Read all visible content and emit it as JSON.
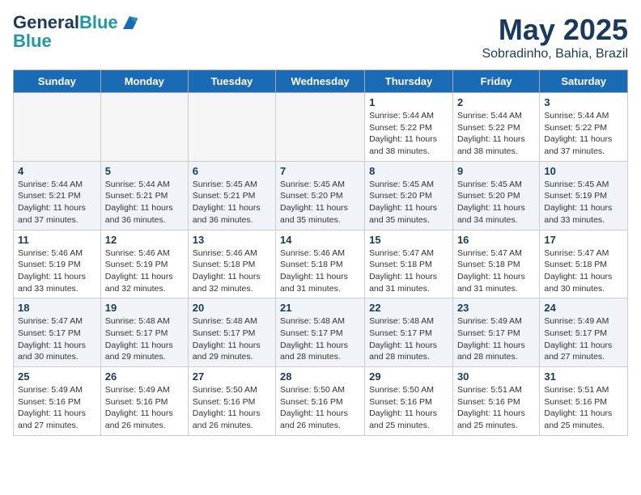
{
  "logo": {
    "line1": "General",
    "line2": "Blue"
  },
  "title": "May 2025",
  "location": "Sobradinho, Bahia, Brazil",
  "weekdays": [
    "Sunday",
    "Monday",
    "Tuesday",
    "Wednesday",
    "Thursday",
    "Friday",
    "Saturday"
  ],
  "weeks": [
    [
      {
        "day": "",
        "info": ""
      },
      {
        "day": "",
        "info": ""
      },
      {
        "day": "",
        "info": ""
      },
      {
        "day": "",
        "info": ""
      },
      {
        "day": "1",
        "info": "Sunrise: 5:44 AM\nSunset: 5:22 PM\nDaylight: 11 hours and 38 minutes."
      },
      {
        "day": "2",
        "info": "Sunrise: 5:44 AM\nSunset: 5:22 PM\nDaylight: 11 hours and 38 minutes."
      },
      {
        "day": "3",
        "info": "Sunrise: 5:44 AM\nSunset: 5:22 PM\nDaylight: 11 hours and 37 minutes."
      }
    ],
    [
      {
        "day": "4",
        "info": "Sunrise: 5:44 AM\nSunset: 5:21 PM\nDaylight: 11 hours and 37 minutes."
      },
      {
        "day": "5",
        "info": "Sunrise: 5:44 AM\nSunset: 5:21 PM\nDaylight: 11 hours and 36 minutes."
      },
      {
        "day": "6",
        "info": "Sunrise: 5:45 AM\nSunset: 5:21 PM\nDaylight: 11 hours and 36 minutes."
      },
      {
        "day": "7",
        "info": "Sunrise: 5:45 AM\nSunset: 5:20 PM\nDaylight: 11 hours and 35 minutes."
      },
      {
        "day": "8",
        "info": "Sunrise: 5:45 AM\nSunset: 5:20 PM\nDaylight: 11 hours and 35 minutes."
      },
      {
        "day": "9",
        "info": "Sunrise: 5:45 AM\nSunset: 5:20 PM\nDaylight: 11 hours and 34 minutes."
      },
      {
        "day": "10",
        "info": "Sunrise: 5:45 AM\nSunset: 5:19 PM\nDaylight: 11 hours and 33 minutes."
      }
    ],
    [
      {
        "day": "11",
        "info": "Sunrise: 5:46 AM\nSunset: 5:19 PM\nDaylight: 11 hours and 33 minutes."
      },
      {
        "day": "12",
        "info": "Sunrise: 5:46 AM\nSunset: 5:19 PM\nDaylight: 11 hours and 32 minutes."
      },
      {
        "day": "13",
        "info": "Sunrise: 5:46 AM\nSunset: 5:18 PM\nDaylight: 11 hours and 32 minutes."
      },
      {
        "day": "14",
        "info": "Sunrise: 5:46 AM\nSunset: 5:18 PM\nDaylight: 11 hours and 31 minutes."
      },
      {
        "day": "15",
        "info": "Sunrise: 5:47 AM\nSunset: 5:18 PM\nDaylight: 11 hours and 31 minutes."
      },
      {
        "day": "16",
        "info": "Sunrise: 5:47 AM\nSunset: 5:18 PM\nDaylight: 11 hours and 31 minutes."
      },
      {
        "day": "17",
        "info": "Sunrise: 5:47 AM\nSunset: 5:18 PM\nDaylight: 11 hours and 30 minutes."
      }
    ],
    [
      {
        "day": "18",
        "info": "Sunrise: 5:47 AM\nSunset: 5:17 PM\nDaylight: 11 hours and 30 minutes."
      },
      {
        "day": "19",
        "info": "Sunrise: 5:48 AM\nSunset: 5:17 PM\nDaylight: 11 hours and 29 minutes."
      },
      {
        "day": "20",
        "info": "Sunrise: 5:48 AM\nSunset: 5:17 PM\nDaylight: 11 hours and 29 minutes."
      },
      {
        "day": "21",
        "info": "Sunrise: 5:48 AM\nSunset: 5:17 PM\nDaylight: 11 hours and 28 minutes."
      },
      {
        "day": "22",
        "info": "Sunrise: 5:48 AM\nSunset: 5:17 PM\nDaylight: 11 hours and 28 minutes."
      },
      {
        "day": "23",
        "info": "Sunrise: 5:49 AM\nSunset: 5:17 PM\nDaylight: 11 hours and 28 minutes."
      },
      {
        "day": "24",
        "info": "Sunrise: 5:49 AM\nSunset: 5:17 PM\nDaylight: 11 hours and 27 minutes."
      }
    ],
    [
      {
        "day": "25",
        "info": "Sunrise: 5:49 AM\nSunset: 5:16 PM\nDaylight: 11 hours and 27 minutes."
      },
      {
        "day": "26",
        "info": "Sunrise: 5:49 AM\nSunset: 5:16 PM\nDaylight: 11 hours and 26 minutes."
      },
      {
        "day": "27",
        "info": "Sunrise: 5:50 AM\nSunset: 5:16 PM\nDaylight: 11 hours and 26 minutes."
      },
      {
        "day": "28",
        "info": "Sunrise: 5:50 AM\nSunset: 5:16 PM\nDaylight: 11 hours and 26 minutes."
      },
      {
        "day": "29",
        "info": "Sunrise: 5:50 AM\nSunset: 5:16 PM\nDaylight: 11 hours and 25 minutes."
      },
      {
        "day": "30",
        "info": "Sunrise: 5:51 AM\nSunset: 5:16 PM\nDaylight: 11 hours and 25 minutes."
      },
      {
        "day": "31",
        "info": "Sunrise: 5:51 AM\nSunset: 5:16 PM\nDaylight: 11 hours and 25 minutes."
      }
    ]
  ]
}
